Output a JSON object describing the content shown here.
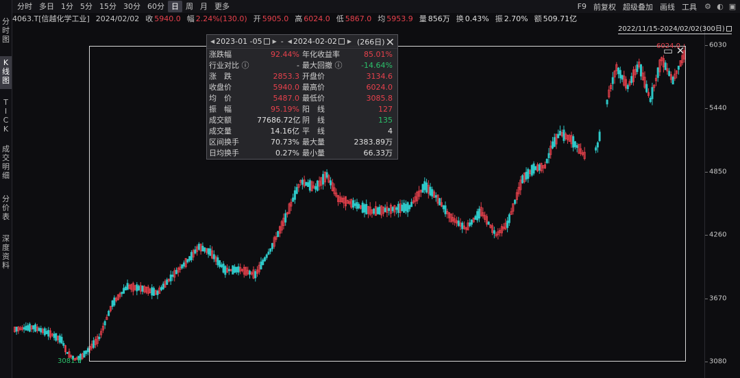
{
  "side_tabs": [
    {
      "id": "fenshi",
      "chars": [
        "分",
        "时",
        "图"
      ],
      "active": false
    },
    {
      "id": "kline",
      "chars": [
        "K",
        "线",
        "图"
      ],
      "active": true
    },
    {
      "id": "tick",
      "chars": [
        "T",
        "I",
        "C",
        "K"
      ],
      "active": false
    },
    {
      "id": "trade-detail",
      "chars": [
        "成",
        "交",
        "明",
        "细"
      ],
      "active": false
    },
    {
      "id": "price-table",
      "chars": [
        "分",
        "价",
        "表"
      ],
      "active": false
    },
    {
      "id": "depth",
      "chars": [
        "深",
        "度",
        "资",
        "料"
      ],
      "active": false
    }
  ],
  "toolbar": {
    "periods": [
      "分时",
      "多日",
      "1分",
      "5分",
      "15分",
      "30分",
      "60分",
      "日",
      "周",
      "月",
      "更多"
    ],
    "active_period": "日",
    "right": [
      "F9",
      "前复权",
      "超级叠加",
      "画线",
      "工具"
    ],
    "right_icons": [
      "settings-icon",
      "palette-icon",
      "wp-icon"
    ]
  },
  "info": {
    "symbol": "4063.T[信越化学工业]",
    "date": "2024/02/02",
    "close_label": "收",
    "close": "5940.0",
    "change_label": "幅",
    "change": "2.24%(130.0)",
    "open_label": "开",
    "open": "5905.0",
    "high_label": "高",
    "high": "6024.0",
    "low_label": "低",
    "low": "5867.0",
    "avg_label": "均",
    "avg": "5953.9",
    "vol_label": "量",
    "vol": "856万",
    "turnover_label": "换",
    "turnover": "0.43%",
    "amp_label": "振",
    "amp": "2.70%",
    "amount_label": "额",
    "amount": "509.71亿"
  },
  "range_label": "2022/11/15-2024/02/02(300日)",
  "marks": {
    "low": "3081.9",
    "high": "6024.0"
  },
  "stats": {
    "start_date": "2023-01 -05",
    "sep": "-",
    "end_date": "2024-02-02",
    "days": "(266日)",
    "rows": [
      {
        "l1": "涨跌幅",
        "v1": "92.44%",
        "c1": "red",
        "l2": "年化收益率",
        "v2": "85.01%",
        "c2": "red"
      },
      {
        "l1": "行业对比 ⓘ",
        "v1": "-",
        "c1": "white",
        "l2": "最大回撤 ⓘ",
        "v2": "-14.64%",
        "c2": "green"
      },
      {
        "l1": "涨　跌",
        "v1": "2853.3",
        "c1": "red",
        "l2": "开盘价",
        "v2": "3134.6",
        "c2": "red"
      },
      {
        "l1": "收盘价",
        "v1": "5940.0",
        "c1": "red",
        "l2": "最高价",
        "v2": "6024.0",
        "c2": "red"
      },
      {
        "l1": "均　价",
        "v1": "5487.0",
        "c1": "red",
        "l2": "最低价",
        "v2": "3085.8",
        "c2": "red"
      },
      {
        "l1": "振　幅",
        "v1": "95.19%",
        "c1": "red",
        "l2": "阳　线",
        "v2": "127",
        "c2": "red"
      },
      {
        "l1": "成交额",
        "v1": "77686.72亿",
        "c1": "white",
        "l2": "阴　线",
        "v2": "135",
        "c2": "green"
      },
      {
        "l1": "成交量",
        "v1": "14.16亿",
        "c1": "white",
        "l2": "平　线",
        "v2": "4",
        "c2": "white"
      },
      {
        "l1": "区间换手",
        "v1": "70.73%",
        "c1": "white",
        "l2": "最大量",
        "v2": "2383.89万",
        "c2": "white"
      },
      {
        "l1": "日均换手",
        "v1": "0.27%",
        "c1": "white",
        "l2": "最小量",
        "v2": "66.33万",
        "c2": "white"
      }
    ]
  },
  "colors": {
    "up": "#e8414c",
    "down": "#2ec8c8",
    "background": "#0d0d10"
  },
  "chart_data": {
    "type": "candlestick",
    "y_ticks": [
      3080,
      3670,
      4260,
      4850,
      5440,
      6030
    ],
    "ylim": [
      3050,
      6100
    ],
    "first_date": "2022/11/15",
    "last_date": "2024/02/02",
    "range_start": "2023/01/05",
    "range_end": "2024/02/02",
    "trend_keypoints": [
      [
        0,
        3380
      ],
      [
        10,
        3400
      ],
      [
        20,
        3330
      ],
      [
        25,
        3280
      ],
      [
        28,
        3160
      ],
      [
        32,
        3100
      ],
      [
        36,
        3130
      ],
      [
        45,
        3300
      ],
      [
        52,
        3620
      ],
      [
        60,
        3780
      ],
      [
        68,
        3760
      ],
      [
        76,
        3720
      ],
      [
        84,
        3880
      ],
      [
        92,
        4020
      ],
      [
        98,
        4150
      ],
      [
        104,
        4100
      ],
      [
        112,
        3930
      ],
      [
        120,
        3940
      ],
      [
        128,
        3890
      ],
      [
        136,
        4120
      ],
      [
        144,
        4420
      ],
      [
        152,
        4760
      ],
      [
        160,
        4700
      ],
      [
        166,
        4820
      ],
      [
        172,
        4600
      ],
      [
        180,
        4550
      ],
      [
        190,
        4480
      ],
      [
        200,
        4500
      ],
      [
        210,
        4520
      ],
      [
        218,
        4720
      ],
      [
        224,
        4620
      ],
      [
        232,
        4420
      ],
      [
        240,
        4320
      ],
      [
        248,
        4480
      ],
      [
        256,
        4260
      ],
      [
        262,
        4360
      ],
      [
        270,
        4780
      ],
      [
        276,
        4880
      ],
      [
        282,
        4900
      ],
      [
        286,
        5100
      ],
      [
        290,
        5210
      ],
      [
        296,
        5150
      ],
      [
        302,
        5020
      ],
      [
        306,
        4950
      ],
      [
        310,
        5100
      ],
      [
        316,
        5580
      ],
      [
        320,
        5820
      ],
      [
        326,
        5640
      ],
      [
        332,
        5850
      ],
      [
        338,
        5520
      ],
      [
        344,
        5900
      ],
      [
        350,
        5700
      ],
      [
        356,
        5940
      ]
    ],
    "gaps": [
      [
        304,
        308
      ],
      [
        312,
        314
      ]
    ]
  }
}
